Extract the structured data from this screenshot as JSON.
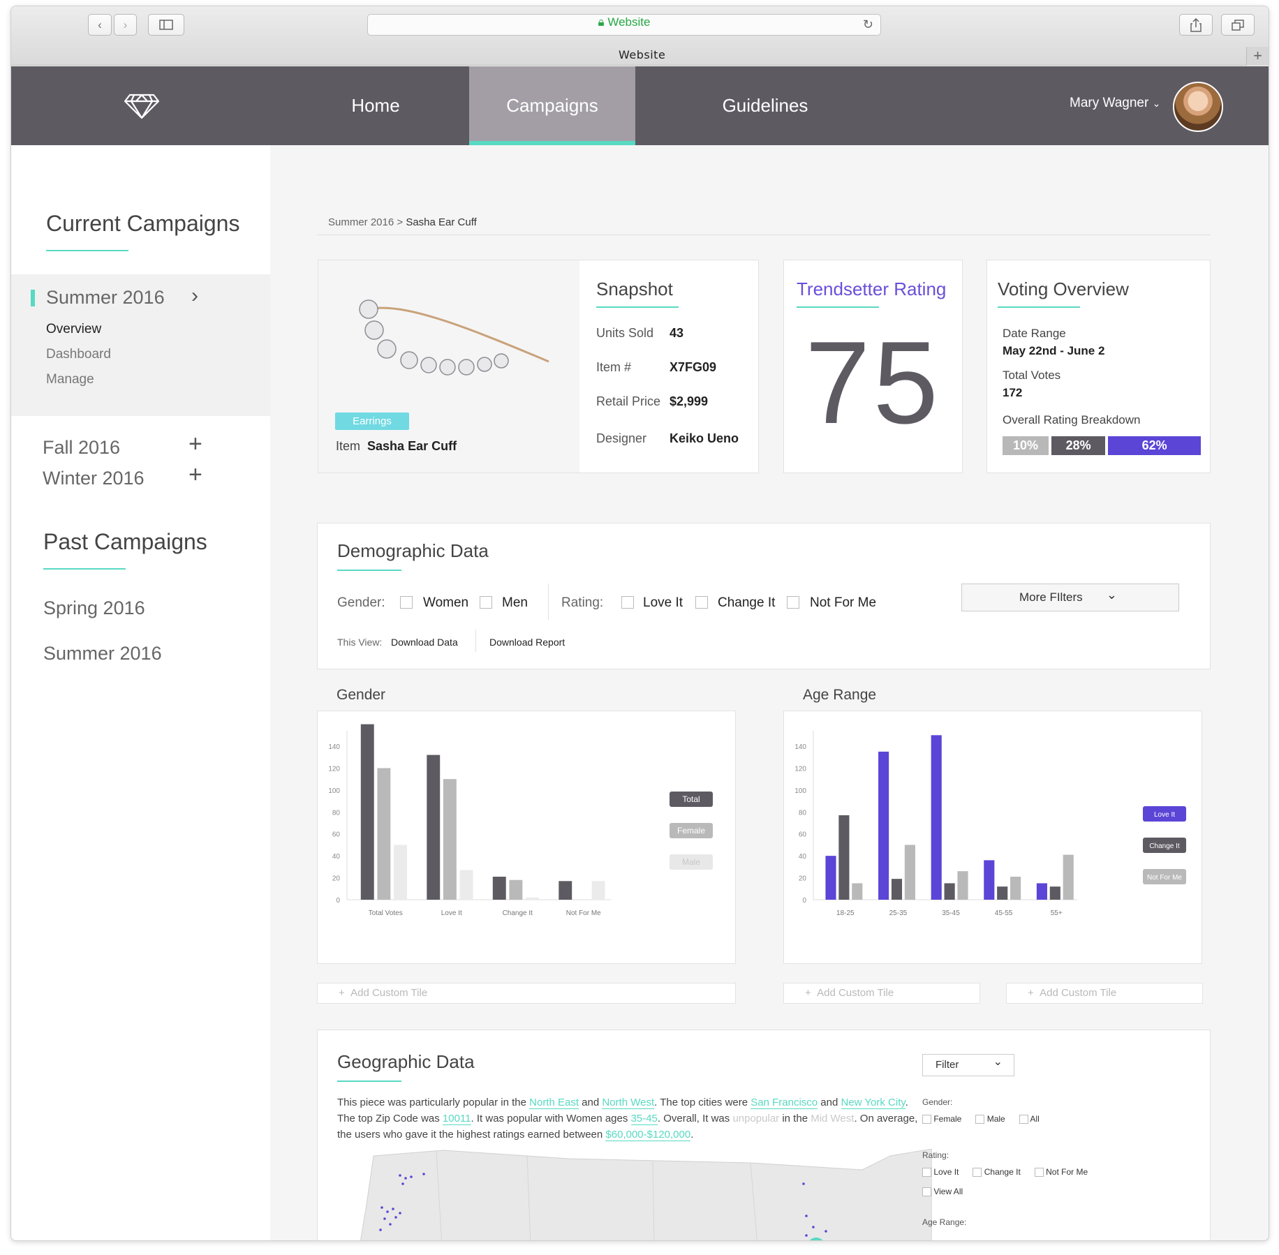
{
  "browser": {
    "site_label": "Website",
    "tab_title": "Website"
  },
  "nav": {
    "home": "Home",
    "campaigns": "Campaigns",
    "guidelines": "Guidelines",
    "user_name": "Mary Wagner"
  },
  "sidebar": {
    "current_heading": "Current Campaigns",
    "active_campaign": "Summer 2016",
    "sub_items": [
      "Overview",
      "Dashboard",
      "Manage"
    ],
    "collapsed": [
      "Fall 2016",
      "Winter 2016"
    ],
    "past_heading": "Past Campaigns",
    "past": [
      "Spring 2016",
      "Summer 2016"
    ]
  },
  "breadcrumb": {
    "parent": "Summer 2016 >",
    "current": "Sasha Ear Cuff"
  },
  "product": {
    "tag": "Earrings",
    "item_label": "Item",
    "item_name": "Sasha Ear Cuff"
  },
  "snapshot": {
    "title": "Snapshot",
    "rows": [
      {
        "k": "Units Sold",
        "v": "43"
      },
      {
        "k": "Item #",
        "v": "X7FG09"
      },
      {
        "k": "Retail Price",
        "v": "$2,999"
      },
      {
        "k": "Designer",
        "v": "Keiko Ueno"
      }
    ]
  },
  "trendsetter": {
    "title": "Trendsetter Rating",
    "value": "75",
    "accent": "#6a4fd8"
  },
  "voting": {
    "title": "Voting Overview",
    "date_label": "Date Range",
    "date_value": "May 22nd - June 2",
    "votes_label": "Total Votes",
    "votes_value": "172",
    "breakdown_label": "Overall Rating Breakdown",
    "breakdown": [
      {
        "label": "10%",
        "value": 10,
        "color": "#b8b8b8"
      },
      {
        "label": "28%",
        "value": 28,
        "color": "#5e5a62"
      },
      {
        "label": "62%",
        "value": 62,
        "color": "#5b45d6"
      }
    ]
  },
  "demographic": {
    "title": "Demographic Data",
    "gender_label": "Gender:",
    "gender_opts": [
      "Women",
      "Men"
    ],
    "rating_label": "Rating:",
    "rating_opts": [
      "Love It",
      "Change It",
      "Not For Me"
    ],
    "more_filters": "More FIlters",
    "this_view": "This View:",
    "download_data": "Download Data",
    "download_report": "Download Report"
  },
  "sections": {
    "gender": "Gender",
    "age": "Age Range",
    "add_tile": "Add Custom Tile"
  },
  "chart_data": [
    {
      "type": "bar",
      "categories": [
        "Total Votes",
        "Love It",
        "Change It",
        "Not For Me"
      ],
      "series": [
        {
          "name": "Total",
          "color": "#5e5a62",
          "values": [
            160,
            132,
            21,
            17
          ]
        },
        {
          "name": "Female",
          "color": "#b9b9b9",
          "values": [
            120,
            110,
            18,
            0
          ]
        },
        {
          "name": "Male",
          "color": "#ebebeb",
          "values": [
            50,
            27,
            2,
            17
          ]
        }
      ],
      "ylim": [
        0,
        140
      ],
      "yticks": [
        0,
        20,
        40,
        60,
        80,
        100,
        120,
        140
      ]
    },
    {
      "type": "bar",
      "categories": [
        "18-25",
        "25-35",
        "35-45",
        "45-55",
        "55+"
      ],
      "series": [
        {
          "name": "Love It",
          "color": "#5b45d6",
          "values": [
            40,
            135,
            150,
            36,
            15
          ]
        },
        {
          "name": "Change It",
          "color": "#5e5a62",
          "values": [
            77,
            19,
            15,
            12,
            12
          ]
        },
        {
          "name": "Not For Me",
          "color": "#b9b9b9",
          "values": [
            15,
            50,
            26,
            21,
            41
          ]
        }
      ],
      "ylim": [
        0,
        140
      ],
      "yticks": [
        0,
        20,
        40,
        60,
        80,
        100,
        120,
        140
      ]
    }
  ],
  "geo": {
    "title": "Geographic Data",
    "t1": "This piece was particularly popular in the ",
    "l1": "North East",
    "t2": " and ",
    "l2": "North West",
    "t3": ". The top cities were ",
    "l3": "San Francisco",
    "t4": " and ",
    "l4": "New York City",
    "t5": ".",
    "t6": "The top Zip Code was ",
    "l5": "10011",
    "t7": ". It was popular with Women ages ",
    "l6": "35-45",
    "t8": ". Overall, It was ",
    "d1": "unpopular",
    "t9": " in the ",
    "d2": "Mid West",
    "t10": ". On average,",
    "t11": "the users who gave it the highest ratings earned between ",
    "l7": "$60,000-$120,000",
    "t12": ".",
    "filter": "Filter",
    "gender_label": "Gender:",
    "gender_opts": [
      "Female",
      "Male",
      "All"
    ],
    "rating_label": "Rating:",
    "rating_opts": [
      "Love It",
      "Change It",
      "Not For Me"
    ],
    "view_all": "View All",
    "age_label": "Age Range:"
  }
}
